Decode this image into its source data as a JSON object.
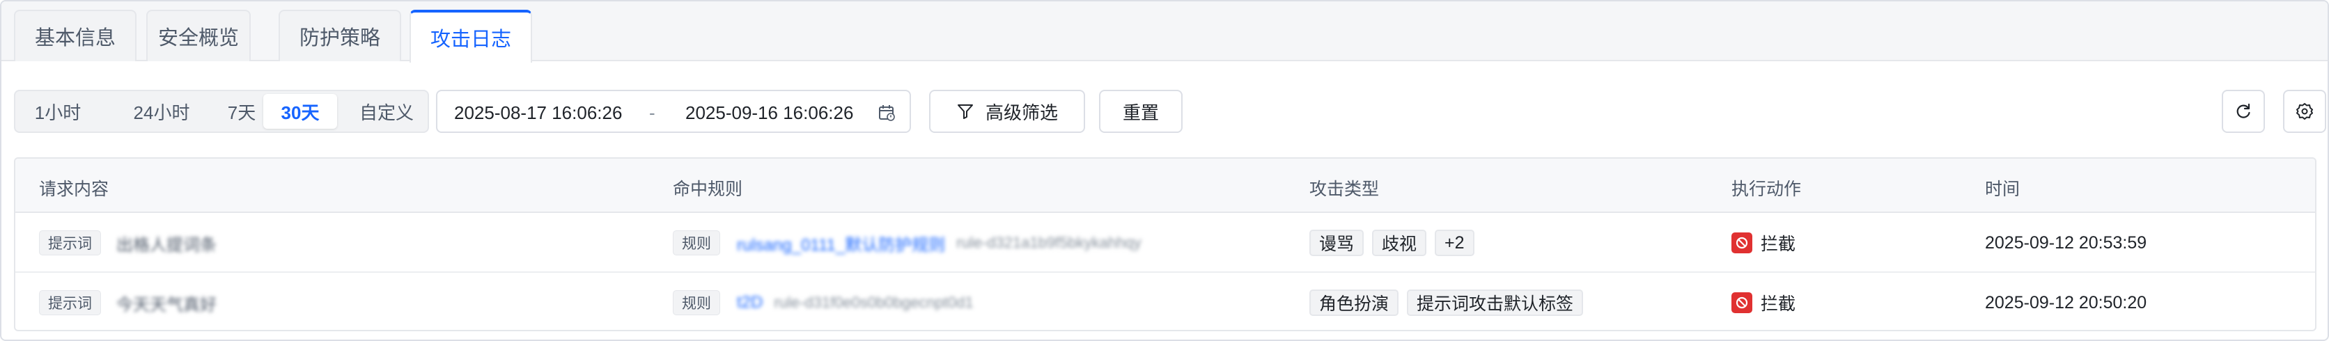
{
  "tabs": [
    {
      "label": "基本信息",
      "active": false
    },
    {
      "label": "安全概览",
      "active": false
    },
    {
      "label": "防护策略",
      "active": false
    },
    {
      "label": "攻击日志",
      "active": true
    }
  ],
  "time_ranges": [
    {
      "label": "1小时",
      "active": false
    },
    {
      "label": "24小时",
      "active": false
    },
    {
      "label": "7天",
      "active": false
    },
    {
      "label": "30天",
      "active": true
    },
    {
      "label": "自定义",
      "active": false
    }
  ],
  "date_range": {
    "start": "2025-08-17 16:06:26",
    "separator": "-",
    "end": "2025-09-16 16:06:26"
  },
  "toolbar": {
    "advanced_filter_label": "高级筛选",
    "reset_label": "重置",
    "refresh_icon": "refresh-icon",
    "settings_icon": "settings-gear-icon"
  },
  "table": {
    "columns": [
      "请求内容",
      "命中规则",
      "攻击类型",
      "执行动作",
      "时间"
    ],
    "rows": [
      {
        "request_tag": "提示词",
        "request_text": "出格人提词条",
        "rule_tag": "规则",
        "rule_name": "rulsang_0111_默认防护规则",
        "rule_id": "rule-d321a1b9f5bkykahhqy",
        "attack_types": [
          "谩骂",
          "歧视",
          "+2"
        ],
        "action": "拦截",
        "time": "2025-09-12 20:53:59"
      },
      {
        "request_tag": "提示词",
        "request_text": "今天天气真好",
        "rule_tag": "规则",
        "rule_name": "t2D",
        "rule_id": "rule-d31f0e0s0b0bgecnpt0d1",
        "attack_types": [
          "角色扮演",
          "提示词攻击默认标签"
        ],
        "action": "拦截",
        "time": "2025-09-12 20:50:20"
      }
    ]
  },
  "colors": {
    "accent": "#1664ff",
    "block": "#e03131",
    "header_bg": "#f7f8fa"
  }
}
